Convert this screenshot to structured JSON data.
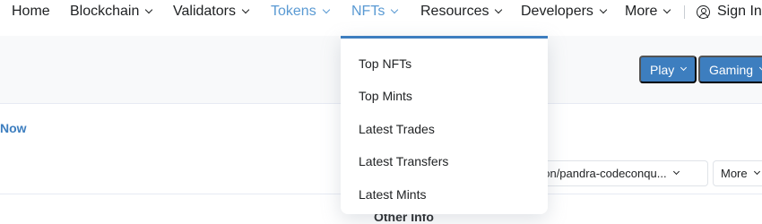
{
  "nav": {
    "home": "Home",
    "blockchain": "Blockchain",
    "validators": "Validators",
    "tokens": "Tokens",
    "nfts": "NFTs",
    "resources": "Resources",
    "developers": "Developers",
    "more": "More",
    "sign_in": "Sign In"
  },
  "toolbar": {
    "play": "Play",
    "gaming": "Gaming"
  },
  "main": {
    "now_link": "Now",
    "path_field": "ection/pandra-codeconqu...",
    "more_button": "More",
    "other_info": "Other Info"
  },
  "nfts_menu": {
    "items": [
      "Top NFTs",
      "Top Mints",
      "Latest Trades",
      "Latest Transfers",
      "Latest Mints"
    ]
  },
  "colors": {
    "accent": "#3d7ebf",
    "active_nav": "#5a9ad3"
  }
}
